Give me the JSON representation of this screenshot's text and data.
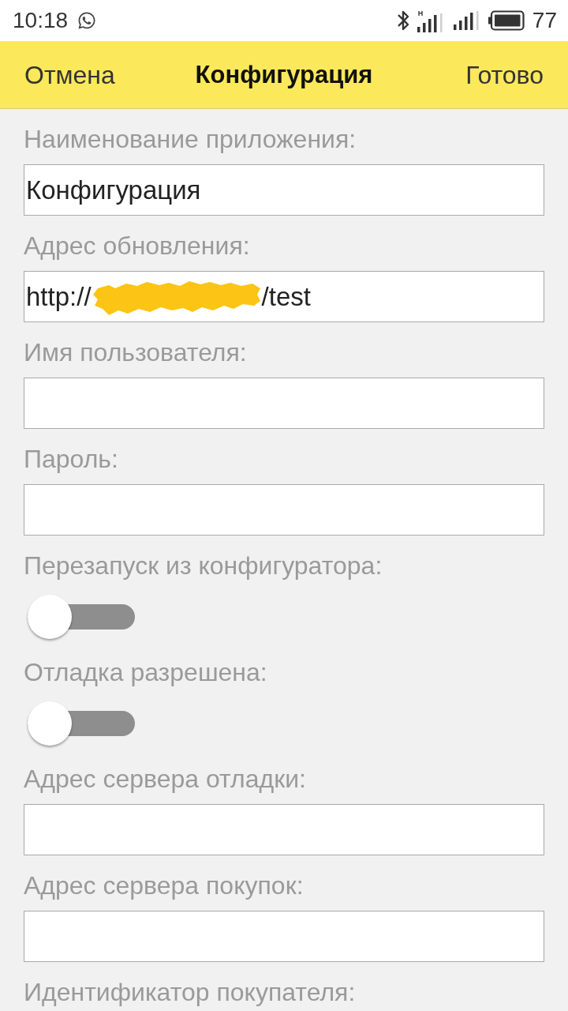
{
  "status_bar": {
    "time": "10:18",
    "network": "H",
    "battery": "77"
  },
  "toolbar": {
    "cancel": "Отмена",
    "title": "Конфигурация",
    "done": "Готово"
  },
  "form": {
    "fields": [
      {
        "kind": "text",
        "label": "Наименование приложения:",
        "value": "Конфигурация"
      },
      {
        "kind": "text",
        "label": "Адрес обновления:",
        "value": "http://",
        "value_end": "/test",
        "redacted": true
      },
      {
        "kind": "text",
        "label": "Имя пользователя:"
      },
      {
        "kind": "text",
        "label": "Пароль:"
      },
      {
        "kind": "toggle",
        "label": "Перезапуск из конфигуратора:",
        "on": false
      },
      {
        "kind": "toggle",
        "label": "Отладка разрешена:",
        "on": false
      },
      {
        "kind": "text",
        "label": "Адрес сервера отладки:"
      },
      {
        "kind": "text",
        "label": "Адрес сервера покупок:"
      },
      {
        "kind": "label",
        "label": "Идентификатор покупателя:"
      }
    ]
  }
}
